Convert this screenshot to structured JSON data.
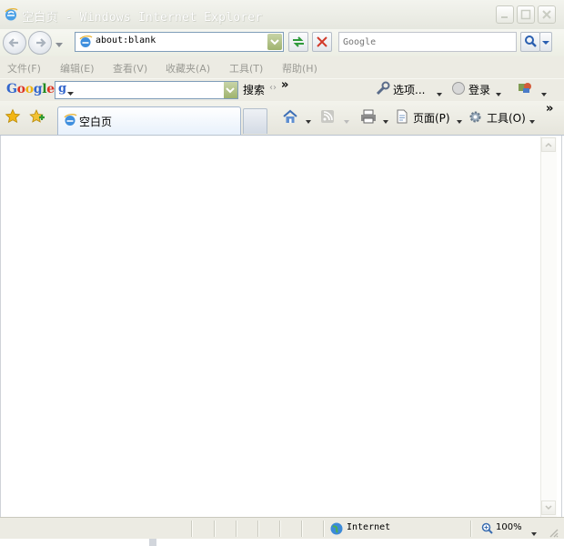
{
  "window": {
    "title": "空白页 - Windows Internet Explorer"
  },
  "address_bar": {
    "url": "about:blank"
  },
  "search": {
    "placeholder": "Google"
  },
  "menu": {
    "items": [
      {
        "label": "文件(F)"
      },
      {
        "label": "编辑(E)"
      },
      {
        "label": "查看(V)"
      },
      {
        "label": "收藏夹(A)"
      },
      {
        "label": "工具(T)"
      },
      {
        "label": "帮助(H)"
      }
    ]
  },
  "google_toolbar": {
    "search_button": "搜索",
    "options": "选项...",
    "login": "登录",
    "more": "»"
  },
  "tabs": [
    {
      "label": "空白页"
    }
  ],
  "command_bar": {
    "page": "页面(P)",
    "tools": "工具(O)",
    "more": "»"
  },
  "status": {
    "zone": "Internet",
    "zoom": "100%"
  },
  "colors": {
    "google_blue": "#3366cc",
    "google_red": "#dd3322",
    "google_yellow": "#eeb211",
    "google_green": "#228b22"
  }
}
